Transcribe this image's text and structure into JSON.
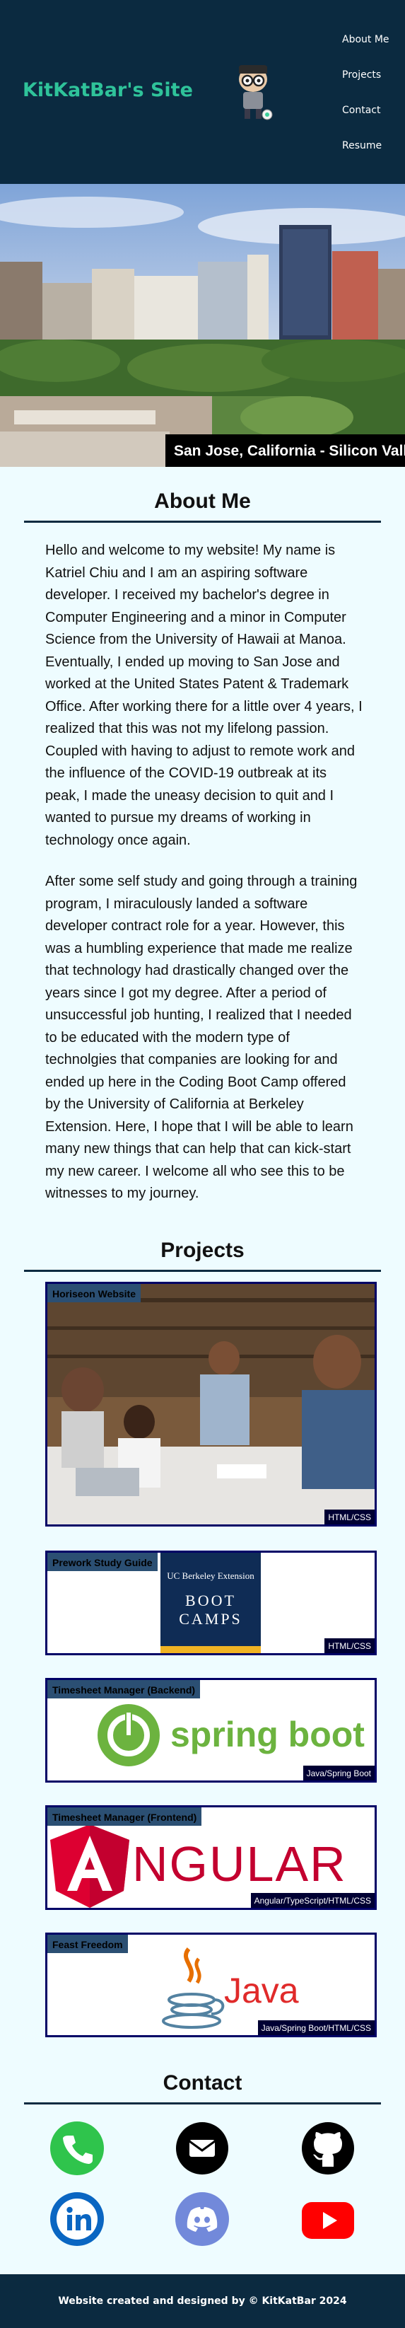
{
  "header": {
    "site_title": "KitKatBar's Site",
    "nav": [
      "About Me",
      "Projects",
      "Contact",
      "Resume"
    ]
  },
  "hero": {
    "caption": "San Jose, California - Silicon Valley"
  },
  "about": {
    "title": "About Me",
    "paragraphs": [
      "Hello and welcome to my website! My name is Katriel Chiu and I am an aspiring software developer. I received my bachelor's degree in Computer Engineering and a minor in Computer Science from the University of Hawaii at Manoa. Eventually, I ended up moving to San Jose and worked at the United States Patent & Trademark Office. After working there for a little over 4 years, I realized that this was not my lifelong passion. Coupled with having to adjust to remote work and the influence of the COVID-19 outbreak at its peak, I made the uneasy decision to quit and I wanted to pursue my dreams of working in technology once again.",
      "After some self study and going through a training program, I miraculously landed a software developer contract role for a year. However, this was a humbling experience that made me realize that technology had drastically changed over the years since I got my degree. After a period of unsuccessful job hunting, I realized that I needed to be educated with the modern type of technolgies that companies are looking for and ended up here in the Coding Boot Camp offered by the University of California at Berkeley Extension. Here, I hope that I will be able to learn many new things that can help that can kick-start my new career. I welcome all who see this to be witnesses to my journey."
    ]
  },
  "projects": {
    "title": "Projects",
    "items": [
      {
        "name": "Horiseon Website",
        "tech": "HTML/CSS"
      },
      {
        "name": "Prework Study Guide",
        "tech": "HTML/CSS",
        "image_text": [
          "UC Berkeley Extension",
          "BOOT",
          "CAMPS"
        ]
      },
      {
        "name": "Timesheet Manager (Backend)",
        "tech": "Java/Spring Boot",
        "image_text": [
          "spring boot"
        ]
      },
      {
        "name": "Timesheet Manager (Frontend)",
        "tech": "Angular/TypeScript/HTML/CSS",
        "image_text": [
          "NGULAR"
        ]
      },
      {
        "name": "Feast Freedom",
        "tech": "Java/Spring Boot/HTML/CSS",
        "image_text": [
          "Java"
        ]
      }
    ]
  },
  "contact": {
    "title": "Contact",
    "icons": [
      "phone-icon",
      "email-icon",
      "github-icon",
      "linkedin-icon",
      "discord-icon",
      "youtube-icon"
    ]
  },
  "footer": {
    "text": "Website created and designed by © KitKatBar 2024"
  },
  "colors": {
    "header_bg": "#0b2a40",
    "logo": "#2fc39a",
    "page_bg": "#eefcff",
    "card_border": "#000066"
  }
}
